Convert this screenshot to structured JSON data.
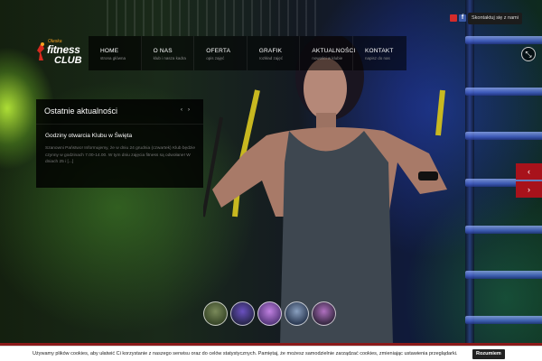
{
  "header": {
    "contact_label": "Skontaktuj się z nami",
    "social": [
      {
        "icon": "youtube-icon",
        "color": "#d42b2b"
      },
      {
        "icon": "facebook-icon",
        "color": "#3b5aa8",
        "glyph": "f"
      }
    ]
  },
  "logo": {
    "small": "Oleska",
    "main": "fitness",
    "club": "CLUB",
    "accent": "#f4a020"
  },
  "nav": {
    "items": [
      {
        "label": "HOME",
        "sub": "strona główna"
      },
      {
        "label": "O NAS",
        "sub": "klub i nasza kadra"
      },
      {
        "label": "OFERTA",
        "sub": "opis zajęć"
      },
      {
        "label": "GRAFIK",
        "sub": "rozkład zajęć"
      },
      {
        "label": "AKTUALNOŚCI",
        "sub": "nowości w klubie"
      },
      {
        "label": "KONTAKT",
        "sub": "napisz do nas"
      }
    ]
  },
  "news": {
    "heading": "Ostatnie aktualności",
    "prev": "‹",
    "next": "›",
    "title": "Godziny otwarcia Klubu w Święta",
    "body": "Szanowni Państwo! Informujemy, że w dniu 24 grudnia (czwartek) Klub będzie czynny w godzinach 7.00-14.00. W tym dniu zajęcia fitness są odwołane! W dniach 25 i [...]"
  },
  "slider": {
    "up": "‹",
    "down": "›",
    "accent": "#a8121b"
  },
  "thumbnails": [
    {
      "name": "thumb-1",
      "color": "#3b4a2a"
    },
    {
      "name": "thumb-2",
      "color": "#2a2850"
    },
    {
      "name": "thumb-3",
      "color": "#5a3a80"
    },
    {
      "name": "thumb-4",
      "color": "#2d3c55"
    },
    {
      "name": "thumb-5",
      "color": "#3a2a45"
    }
  ],
  "cookie": {
    "text": "Używamy plików cookies, aby ułatwić Ci korzystanie z naszego serwisu oraz do celów statystycznych. Pamiętaj, że możesz samodzielnie zarządzać cookies, zmieniając ustawienia przeglądarki.",
    "button": "Rozumiem"
  }
}
